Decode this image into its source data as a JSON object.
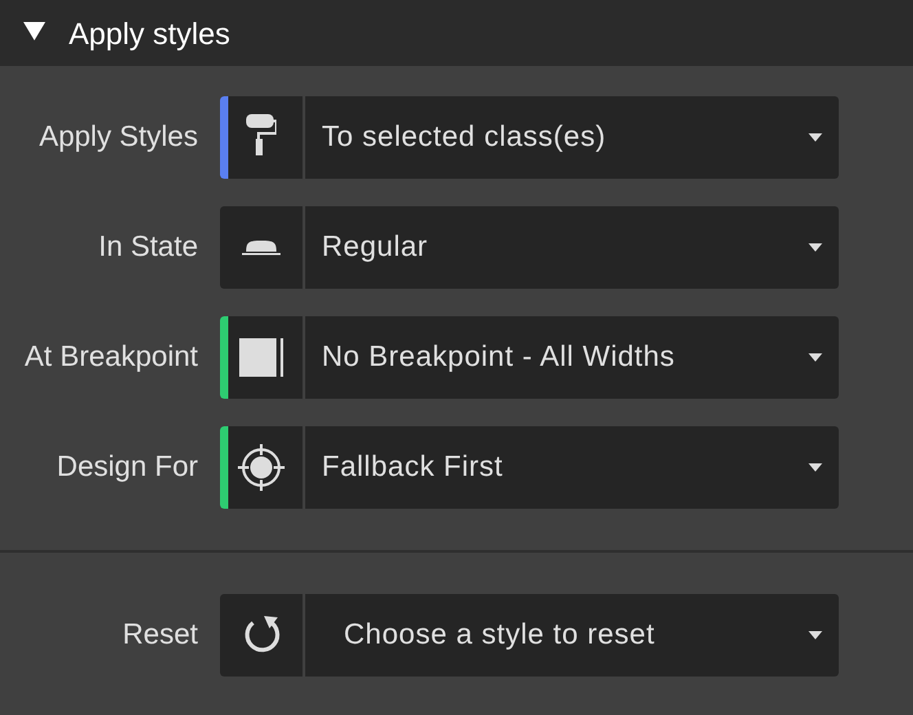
{
  "section": {
    "title": "Apply styles",
    "expanded": true
  },
  "rows": [
    {
      "label": "Apply Styles",
      "value": "To selected class(es)",
      "color": "#5a7ff0"
    },
    {
      "label": "In State",
      "value": "Regular"
    },
    {
      "label": "At Breakpoint",
      "value": "No Breakpoint - All Widths",
      "color": "#2ecc71"
    },
    {
      "label": "Design For",
      "value": "Fallback First",
      "color": "#2ecc71"
    }
  ],
  "reset": {
    "label": "Reset",
    "value": "Choose a style to reset"
  }
}
